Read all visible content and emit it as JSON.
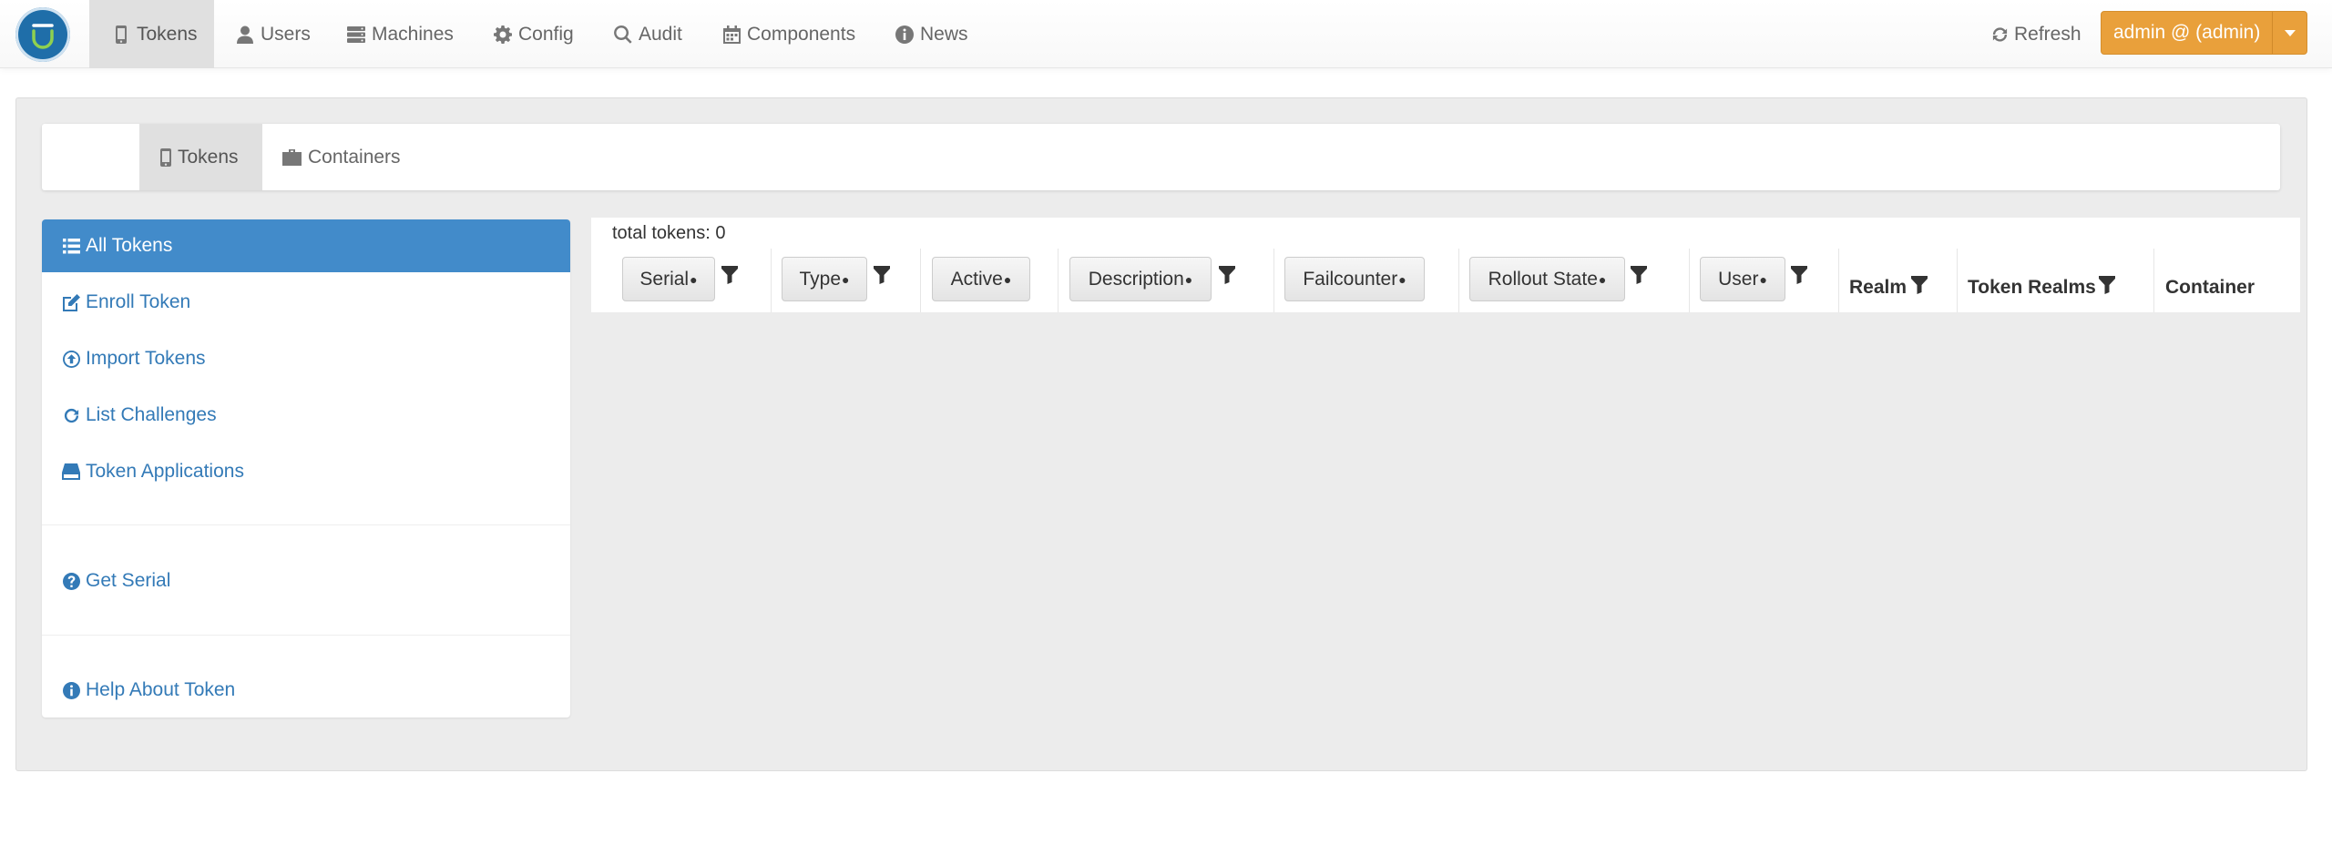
{
  "navbar": {
    "items": [
      {
        "label": "Tokens",
        "icon": "mobile-icon",
        "active": true
      },
      {
        "label": "Users",
        "icon": "user-icon"
      },
      {
        "label": "Machines",
        "icon": "server-icon"
      },
      {
        "label": "Config",
        "icon": "gear-icon"
      },
      {
        "label": "Audit",
        "icon": "search-icon"
      },
      {
        "label": "Components",
        "icon": "calendar-icon"
      },
      {
        "label": "News",
        "icon": "info-circle-icon"
      }
    ],
    "refresh_label": "Refresh",
    "user_label": "admin @ (admin)"
  },
  "subnav": {
    "tabs": [
      {
        "label": "Tokens",
        "icon": "mobile-icon",
        "active": true
      },
      {
        "label": "Containers",
        "icon": "briefcase-icon"
      }
    ]
  },
  "sidebar": {
    "items": [
      {
        "label": "All Tokens",
        "icon": "list-icon",
        "active": true
      },
      {
        "label": "Enroll Token",
        "icon": "edit-icon"
      },
      {
        "label": "Import Tokens",
        "icon": "upload-circle-icon"
      },
      {
        "label": "List Challenges",
        "icon": "refresh-icon"
      },
      {
        "label": "Token Applications",
        "icon": "hdd-icon"
      },
      {
        "label": "Get Serial",
        "icon": "question-circle-icon"
      },
      {
        "label": "Help About Token",
        "icon": "info-circle-icon"
      }
    ]
  },
  "table": {
    "total_label": "total tokens: 0",
    "sortable_columns": [
      {
        "label": "Serial",
        "filter": true
      },
      {
        "label": "Type",
        "filter": true
      },
      {
        "label": "Active",
        "filter": false
      },
      {
        "label": "Description",
        "filter": true
      },
      {
        "label": "Failcounter",
        "filter": false
      },
      {
        "label": "Rollout State",
        "filter": true
      },
      {
        "label": "User",
        "filter": true
      }
    ],
    "plain_columns": [
      {
        "label": "Realm",
        "filter": true
      },
      {
        "label": "Token Realms",
        "filter": true
      },
      {
        "label": "Container",
        "filter": false
      }
    ],
    "sort_indicator": "●"
  },
  "colors": {
    "accent": "#428bca",
    "link": "#337ab7",
    "admin_button": "#e9a03b",
    "logo": "#1f6ea9"
  }
}
